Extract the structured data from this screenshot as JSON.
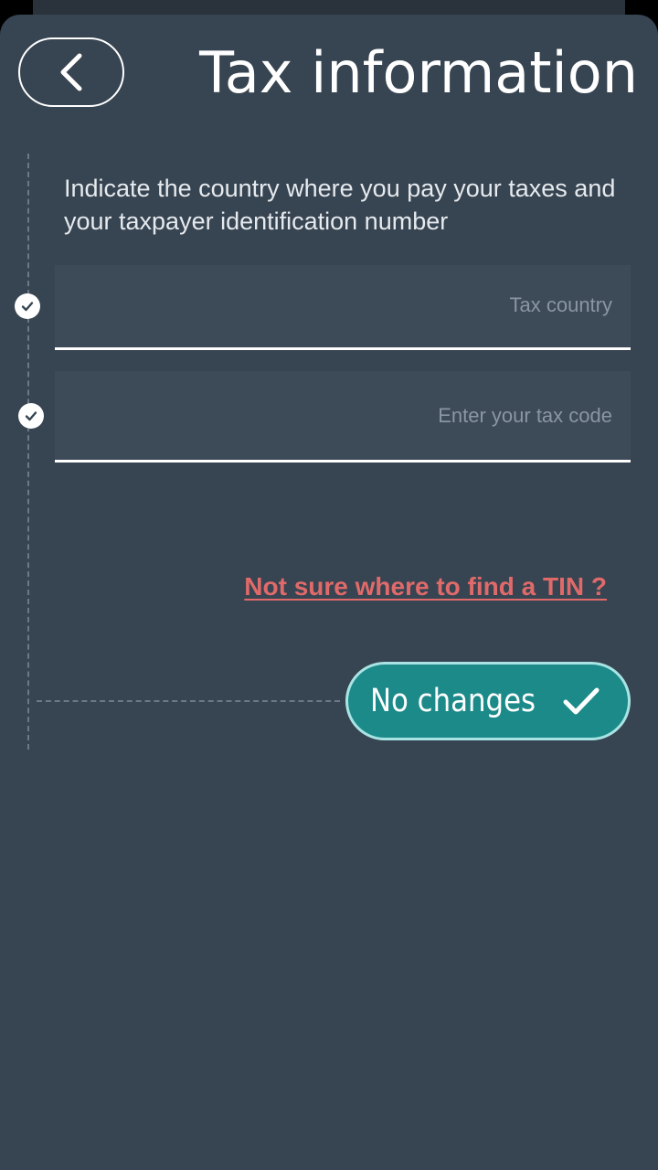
{
  "header": {
    "title": "Tax information",
    "back_icon": "chevron-left-icon"
  },
  "form": {
    "instructions": "Indicate the country where you pay your taxes and your taxpayer identification number",
    "tax_country": {
      "value": "",
      "placeholder": "Tax country"
    },
    "tax_code": {
      "value": "",
      "placeholder": "Enter your tax code"
    },
    "help_link": "Not sure where to find a TIN ?"
  },
  "actions": {
    "submit_label": "No changes",
    "submit_icon": "checkmark-icon"
  },
  "colors": {
    "background": "#374451",
    "accent": "#1d8a8a",
    "link": "#e06a6a"
  }
}
